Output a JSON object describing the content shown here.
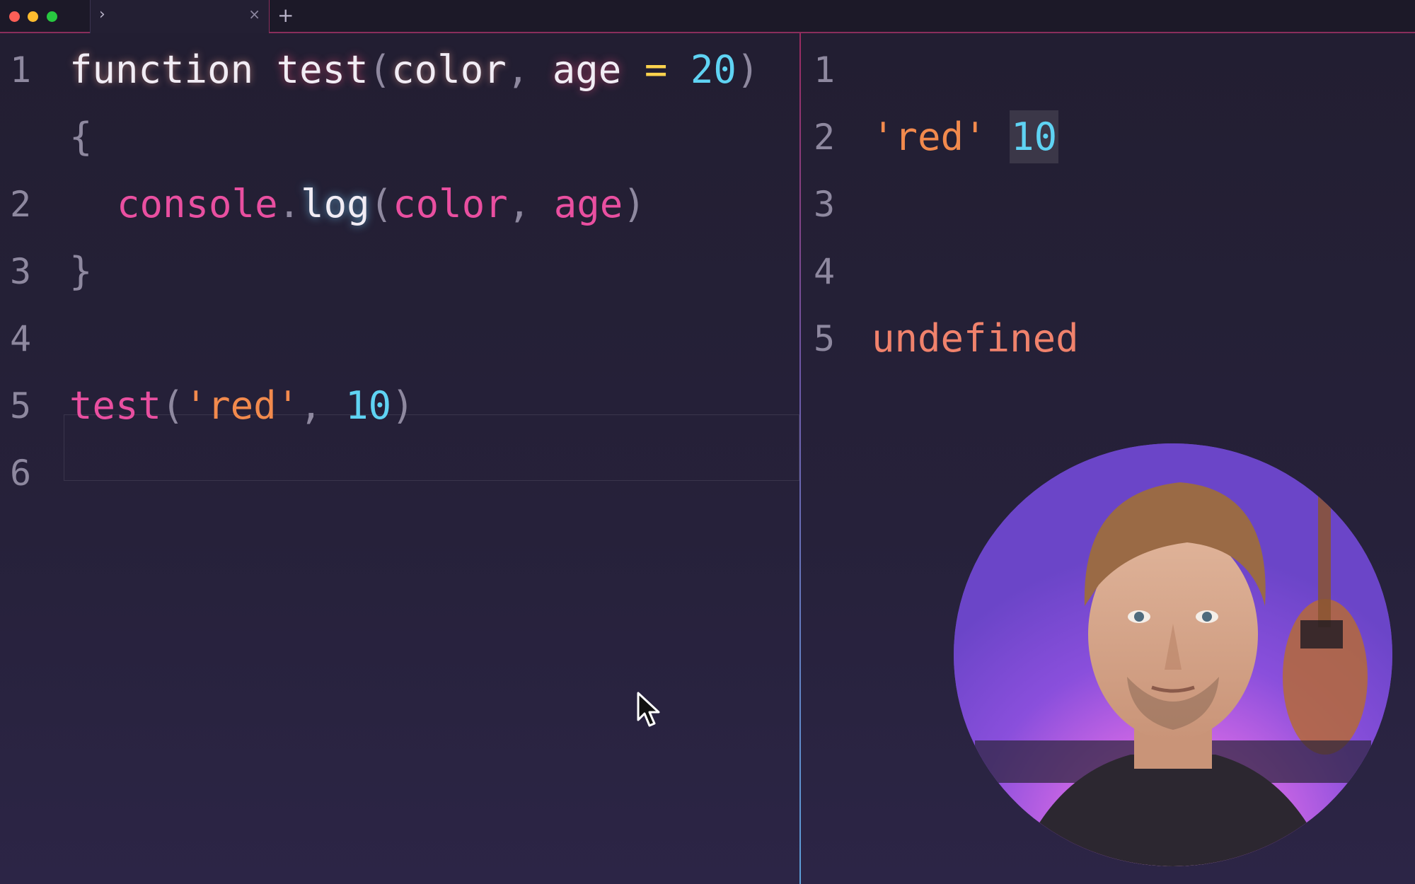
{
  "window": {
    "tab": {
      "chevron": "›",
      "close": "×"
    },
    "new_tab": "+"
  },
  "editor": {
    "lines": [
      {
        "number": "1",
        "tokens": {
          "kw": "function",
          "fn": "test",
          "open": "(",
          "p1": "color",
          "comma": ",",
          "p2": "age",
          "eq": "=",
          "default": "20",
          "close": ")"
        }
      },
      {
        "number": "",
        "tokens": {
          "brace": "{"
        }
      },
      {
        "number": "2",
        "tokens": {
          "obj": "console",
          "dot": ".",
          "method": "log",
          "open": "(",
          "a1": "color",
          "comma": ",",
          "a2": "age",
          "close": ")"
        }
      },
      {
        "number": "3",
        "tokens": {
          "brace": "}"
        }
      },
      {
        "number": "4",
        "tokens": {}
      },
      {
        "number": "5",
        "tokens": {
          "fn": "test",
          "open": "(",
          "str": "'red'",
          "comma": ",",
          "num": "10",
          "close": ")"
        }
      },
      {
        "number": "6",
        "tokens": {}
      }
    ]
  },
  "output": {
    "lines": [
      {
        "number": "1",
        "text": ""
      },
      {
        "number": "2",
        "str": "'red'",
        "num": "10"
      },
      {
        "number": "3",
        "text": ""
      },
      {
        "number": "4",
        "text": ""
      },
      {
        "number": "5",
        "text": "undefined"
      }
    ]
  },
  "colors": {
    "background": "#25213a",
    "keyword": "#f1ecf4",
    "string": "#f28a4d",
    "number": "#5fd3f3",
    "identifier_pink": "#e94fa0",
    "operator": "#fcd34d",
    "undefined": "#f0826c",
    "tab_accent": "#8a2e5c"
  },
  "icons": {
    "traffic_lights": [
      "close-light-icon",
      "minimize-light-icon",
      "maximize-light-icon"
    ],
    "cursor": "mouse-pointer-icon",
    "webcam": "presenter-webcam-image"
  }
}
